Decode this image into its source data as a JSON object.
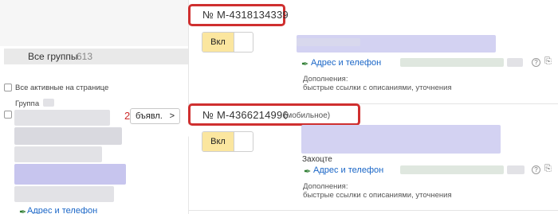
{
  "left_panel": {
    "all_groups_label": "Все группы",
    "all_groups_count": "613",
    "all_active_label": "Все активные на странице",
    "group_label": "Группа",
    "step_number": "2",
    "ads_button_label": "бъявл.",
    "address_link": "Адрес и телефон"
  },
  "ads": [
    {
      "order_number": "№ М-4318134339",
      "order_note": "",
      "toggle_label": "Вкл",
      "address_link": "Адрес и телефон",
      "extras_title": "Дополнения:",
      "extras_value": "быстрые ссылки с описаниями, уточнения"
    },
    {
      "order_number": "№ М-4366214996",
      "order_note": "(мобильное)",
      "partial_text": "Захоцте",
      "toggle_label": "Вкл",
      "address_link": "Адрес и телефон",
      "extras_title": "Дополнения:",
      "extras_value": "быстрые ссылки с описаниями, уточнения"
    }
  ],
  "icons": {
    "address": "pencil-phone-icon",
    "help": "help-icon",
    "chevron": "chevron-right-icon"
  },
  "colors": {
    "highlight_border": "#cf2f2f",
    "toggle_on": "#fbe69f",
    "link": "#1a66c7",
    "address_icon": "#2e7d32"
  }
}
